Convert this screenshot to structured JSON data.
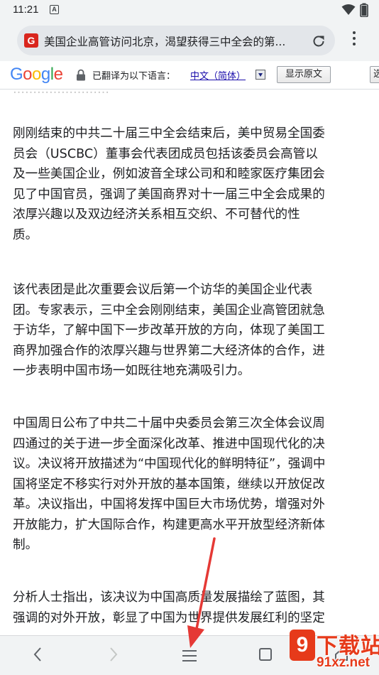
{
  "status_bar": {
    "time": "11:21",
    "notification_letter": "A"
  },
  "browser": {
    "site_icon_letter": "G",
    "url_text": "美国企业高管访问北京，渴望获得三中全会的第..."
  },
  "translate_bar": {
    "logo_letters": [
      "G",
      "o",
      "o",
      "g",
      "l",
      "e"
    ],
    "status_text": "已翻译为以下语言：",
    "language": "中文（简体）",
    "show_original_label": "显示原文",
    "options_label": "选"
  },
  "article": {
    "cut_off_line": "……………………",
    "paragraphs": [
      [
        "刚刚结束的中共二十届三中全会结束后，美中贸易全国委",
        "员会（USCBC）董事会代表团成员包括该委员会高管以",
        "及一些美国企业，例如波音全球公司和和睦家医疗集团会",
        "见了中国官员，强调了美国商界对十一届三中全会成果的",
        "浓厚兴趣以及双边经济关系相互交织、不可替代的性",
        "质。"
      ],
      [
        "该代表团是此次重要会议后第一个访华的美国企业代表",
        "团。专家表示，三中全会刚刚结束，美国企业高管团就急",
        "于访华，了解中国下一步改革开放的方向，体现了美国工",
        "商界加强合作的浓厚兴趣与世界第二大经济体的合作，进",
        "一步表明中国市场一如既往地充满吸引力。"
      ],
      [
        "中国周日公布了中共二十届中央委员会第三次全体会议周",
        "四通过的关于进一步全面深化改革、推进中国现代化的决",
        "议。决议将开放描述为“中国现代化的鲜明特征”，强调中",
        "国将坚定不移实行对外开放的基本国策，继续以开放促改",
        "革。决议指出，中国将发挥中国巨大市场优势，增强对外",
        "开放能力，扩大国际合作，构建更高水平开放型经济新体",
        "制。"
      ],
      [
        "分析人士指出，该决议为中国高质量发展描绘了蓝图，其",
        "强调的对外开放，彰显了中国为世界提供发展红利的坚定"
      ]
    ]
  },
  "watermark": {
    "badge": "9",
    "title": "下载站",
    "url": "91xz.net"
  },
  "colors": {
    "annotation_arrow": "#e53935",
    "watermark": "#e63a1a",
    "link": "#1a0dab"
  },
  "icons": [
    "wifi-icon",
    "battery-icon",
    "reload-icon",
    "more-vert-icon",
    "lock-icon",
    "chevron-left-icon",
    "chevron-right-icon",
    "hamburger-menu-icon",
    "tab-switcher-icon"
  ]
}
